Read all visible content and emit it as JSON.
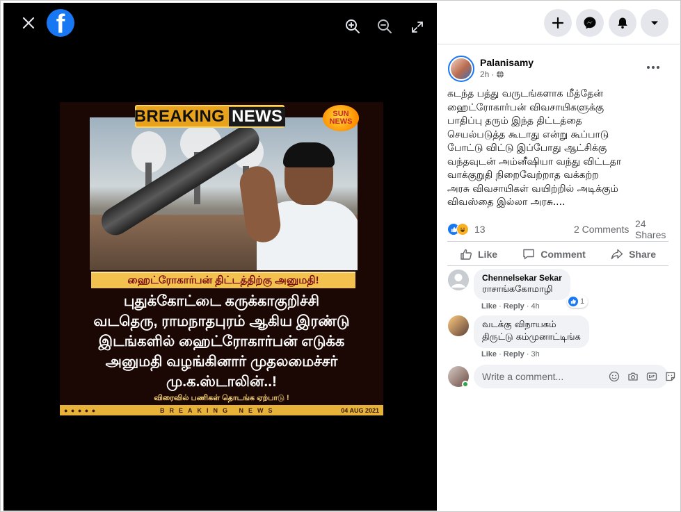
{
  "viewer": {
    "brand_letter": "f",
    "close_icon": "close-icon",
    "zoom_in_icon": "zoom-in-icon",
    "zoom_out_icon": "zoom-out-icon",
    "fullscreen_icon": "fullscreen-icon"
  },
  "poster": {
    "banner_left": "BREAKING",
    "banner_right": "NEWS",
    "channel_top": "SUN",
    "channel_bottom": "NEWS",
    "subtitle": "ஹைட்ரோகார்பன் திட்டத்திற்கு அனுமதி!",
    "headline": [
      "புதுக்கோட்டை கருக்காகுறிச்சி",
      "வடதெரு, ராமநாதபுரம் ஆகிய இரண்டு",
      "இடங்களில் ஹைட்ரோகார்பன் எடுக்க",
      "அனுமதி வழங்கினார் முதலமைச்சர்",
      "மு.க.ஸ்டாலின்..!"
    ],
    "footer_line": "விரைவில் பணிகள் தொடங்க ஏற்பாடு !",
    "ticker_label": "BREAKING NEWS",
    "ticker_date": "04 AUG 2021"
  },
  "top_buttons": [
    "add-icon",
    "messenger-icon",
    "notifications-icon",
    "account-menu-icon"
  ],
  "post": {
    "author": "Palanisamy",
    "time": "2h",
    "audience_icon": "globe-icon",
    "text_lines": [
      "கடந்த பத்து வருடங்களாக மீத்தேன்",
      "ஹைட்ரோகார்பன் விவசாயிகளுக்கு",
      "பாதிப்பு தரும் இந்த திட்டத்தை",
      "செயல்படுத்த கூடாது என்று கூப்பாடு",
      "போட்டு விட்டு இப்போது ஆட்சிக்கு",
      "வந்தவுடன் அம்னீஷியா வந்து விட்டதா",
      "வாக்குறுதி நிறைவேற்றாத வக்கற்ற",
      "அரசு விவசாயிகள் வயிற்றில் அடிக்கும்",
      "விவஸ்தை இல்லா அரசு...."
    ],
    "reaction_count": "13",
    "comments_count": "2 Comments",
    "shares_count": "24 Shares",
    "actions": {
      "like": "Like",
      "comment": "Comment",
      "share": "Share"
    }
  },
  "comments": [
    {
      "name": "Chennelsekar Sekar",
      "text": "ராசாங்ககோமாழி",
      "like": "Like",
      "reply": "Reply",
      "time": "4h",
      "reactions": "1"
    },
    {
      "name": "வடக்கு விநாயகம்",
      "text": "திருட்டு கம்முனாட்டிங்க",
      "like": "Like",
      "reply": "Reply",
      "time": "3h"
    }
  ],
  "composer": {
    "placeholder": "Write a comment...",
    "icons": [
      "emoji-icon",
      "camera-icon",
      "gif-icon",
      "sticker-icon"
    ]
  },
  "colors": {
    "accent": "#1877f2",
    "viewer_bg": "#000000",
    "bubble_bg": "#f0f2f5"
  }
}
